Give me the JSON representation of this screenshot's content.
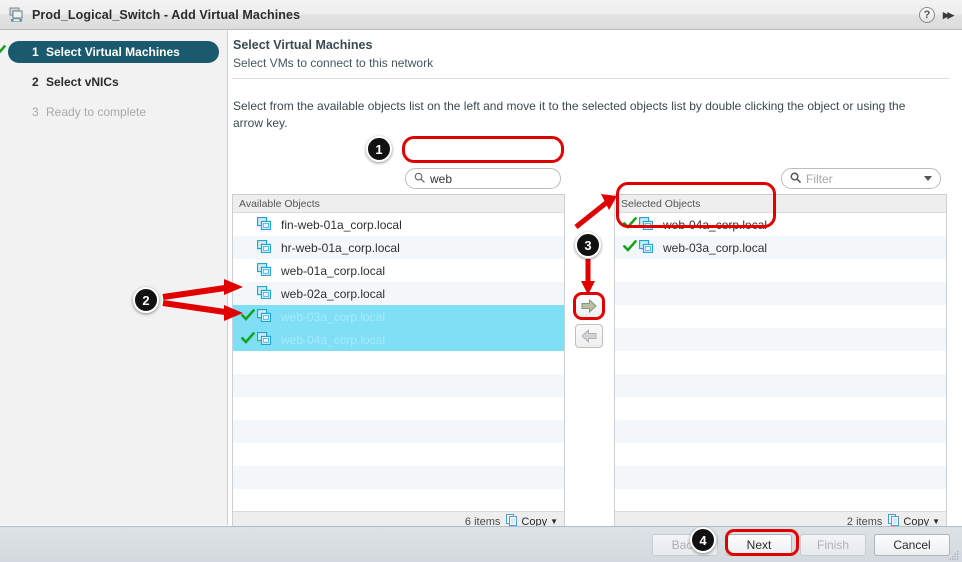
{
  "window": {
    "title": "Prod_Logical_Switch - Add Virtual Machines",
    "app_icon": "virtual-machines-icon",
    "help_icon": "?",
    "collapse_icon": "▶▶"
  },
  "wizard_steps": [
    {
      "num": "1",
      "label": "Select Virtual Machines",
      "state": "active",
      "check": true
    },
    {
      "num": "2",
      "label": "Select vNICs",
      "state": "todo",
      "check": false
    },
    {
      "num": "3",
      "label": "Ready to complete",
      "state": "disabled",
      "check": false
    }
  ],
  "main": {
    "title": "Select Virtual Machines",
    "subtitle": "Select VMs to connect to this network",
    "instructions": "Select from the available objects list on the left and move it to the selected objects list by double clicking the object or using the arrow key."
  },
  "search": {
    "icon": "search-icon",
    "value": "web",
    "placeholder": ""
  },
  "filter": {
    "icon": "search-icon",
    "value": "",
    "placeholder": "Filter",
    "caret": "chevron-down-icon"
  },
  "available_panel": {
    "header": "Available Objects",
    "rows": [
      {
        "name": "fin-web-01a_corp.local",
        "selected": false,
        "checked": false
      },
      {
        "name": "hr-web-01a_corp.local",
        "selected": false,
        "checked": false
      },
      {
        "name": "web-01a_corp.local",
        "selected": false,
        "checked": false
      },
      {
        "name": "web-02a_corp.local",
        "selected": false,
        "checked": false
      },
      {
        "name": "web-03a_corp.local",
        "selected": true,
        "checked": true
      },
      {
        "name": "web-04a_corp.local",
        "selected": true,
        "checked": true
      }
    ],
    "empty_row_count": 7,
    "count_label": "6 items",
    "copy_label": "Copy"
  },
  "selected_panel": {
    "header": "Selected Objects",
    "rows": [
      {
        "name": "web-04a_corp.local",
        "selected": false,
        "checked": true
      },
      {
        "name": "web-03a_corp.local",
        "selected": false,
        "checked": true
      }
    ],
    "empty_row_count": 11,
    "count_label": "2 items",
    "copy_label": "Copy"
  },
  "transfer": {
    "add_icon": "arrow-right-icon",
    "remove_icon": "arrow-left-icon"
  },
  "footer": {
    "back_label": "Back",
    "next_label": "Next",
    "finish_label": "Finish",
    "cancel_label": "Cancel",
    "back_enabled": false,
    "next_enabled": true,
    "finish_enabled": false,
    "cancel_enabled": true
  },
  "annotations": [
    {
      "num": "1",
      "target": "search-input"
    },
    {
      "num": "2",
      "target": "available-selected-rows"
    },
    {
      "num": "3",
      "target": "add-arrow-button"
    },
    {
      "num": "4",
      "target": "next-button"
    }
  ],
  "colors": {
    "accent": "#1b5a6e",
    "annotation_red": "#e00000",
    "row_selected": "#7fe0f5",
    "row_stripe": "#f4f7f9",
    "check_green": "#15a01e",
    "vm_icon": "#29a8d8"
  }
}
